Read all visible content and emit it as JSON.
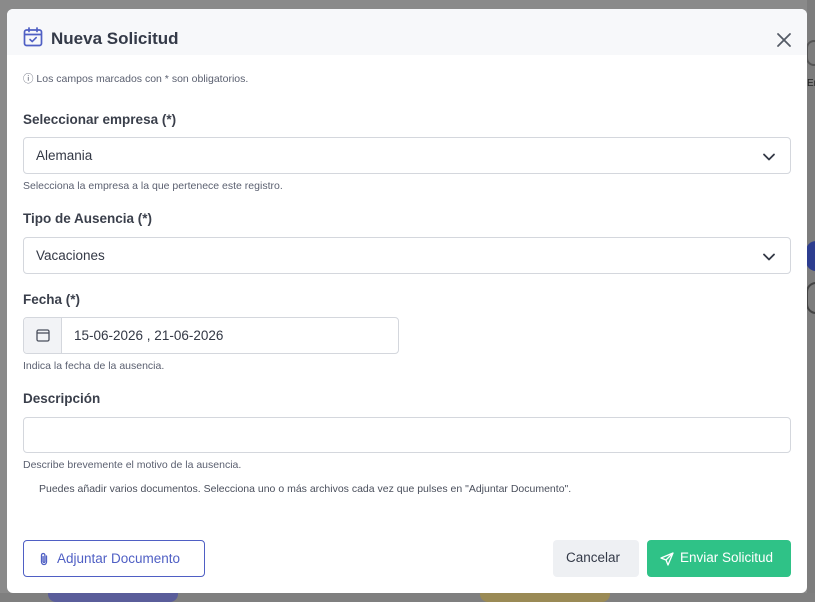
{
  "modal": {
    "title": "Nueva Solicitud",
    "required_note": "ⓘ Los campos marcados con * son obligatorios."
  },
  "form": {
    "empresa": {
      "label": "Seleccionar empresa (*)",
      "value": "Alemania",
      "help": "Selecciona la empresa a la que pertenece este registro."
    },
    "ausencia": {
      "label": "Tipo de Ausencia (*)",
      "value": "Vacaciones"
    },
    "fecha": {
      "label": "Fecha (*)",
      "value": "15-06-2026 , 21-06-2026",
      "help": "Indica la fecha de la ausencia."
    },
    "descripcion": {
      "label": "Descripción",
      "value": "",
      "help": "Describe brevemente el motivo de la ausencia."
    },
    "documents_note": "Puedes añadir varios documentos. Selecciona uno o más archivos cada vez que pulses en \"Adjuntar Documento\"."
  },
  "buttons": {
    "attach": "Adjuntar Documento",
    "cancel": "Cancelar",
    "send": "Enviar Solicitud"
  },
  "background": {
    "right_edge_text": "Er"
  },
  "colors": {
    "primary": "#4f5fc4",
    "success": "#2fc287",
    "overlay": "#8a8a8a"
  },
  "icons": {
    "title": "calendar-check-icon",
    "close": "close-icon",
    "chevron": "chevron-down-icon",
    "date": "calendar-icon",
    "attach": "paperclip-icon",
    "send": "send-icon"
  }
}
